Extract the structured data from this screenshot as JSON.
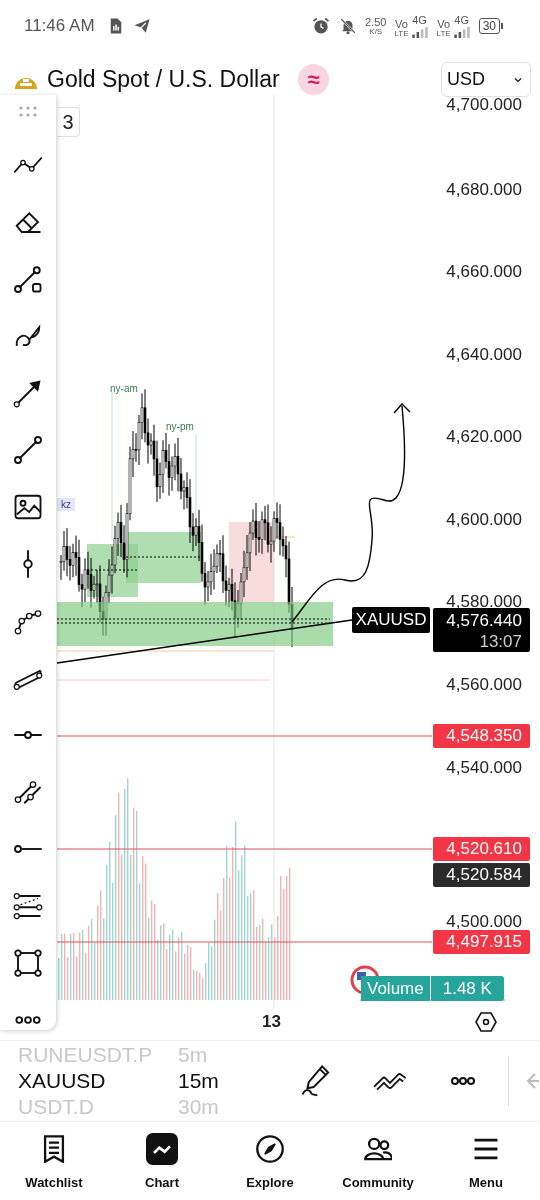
{
  "status_bar": {
    "time": "11:46 AM",
    "net_speed": "2.50",
    "net_unit": "K/S",
    "sims": [
      {
        "vo": "Vo",
        "lte": "LTE",
        "network": "4G"
      },
      {
        "vo": "Vo",
        "lte": "LTE",
        "network": "4G"
      }
    ],
    "battery": "30"
  },
  "header": {
    "title": "Gold Spot / U.S. Dollar",
    "badge": "≈",
    "currency": "USD",
    "legend_tab": "3"
  },
  "chart": {
    "session_labels": [
      {
        "text": "ny-am"
      },
      {
        "text": "ny-pm"
      },
      {
        "text": "kz"
      }
    ],
    "price_axis": [
      "4,700.000",
      "4,680.000",
      "4,660.000",
      "4,640.000",
      "4,620.000",
      "4,600.000",
      "4,580.000",
      "4,560.000",
      "4,540.000",
      "4,500.000"
    ],
    "price_tags": [
      {
        "kind": "alert",
        "price": "4,548.350"
      },
      {
        "kind": "alert",
        "price": "4,520.610"
      },
      {
        "kind": "last",
        "price": "4,520.584"
      },
      {
        "kind": "alert",
        "price": "4,497.915"
      }
    ],
    "current": {
      "symbol": "XAUUSD",
      "price": "4,576.440",
      "countdown": "13:07"
    },
    "volume": {
      "label": "Volume",
      "value": "1.48 K"
    },
    "time_axis": [
      "13"
    ]
  },
  "symbol_bar": {
    "rows": [
      {
        "symbol": "RUNEUSDT.P",
        "interval": "5m",
        "selected": false
      },
      {
        "symbol": "XAUUSD",
        "interval": "15m",
        "selected": true
      },
      {
        "symbol": "USDT.D",
        "interval": "30m",
        "selected": false
      }
    ]
  },
  "bottom_nav": [
    {
      "label": "Watchlist",
      "selected": false
    },
    {
      "label": "Chart",
      "selected": true
    },
    {
      "label": "Explore",
      "selected": false
    },
    {
      "label": "Community",
      "selected": false
    },
    {
      "label": "Menu",
      "selected": false
    }
  ]
}
